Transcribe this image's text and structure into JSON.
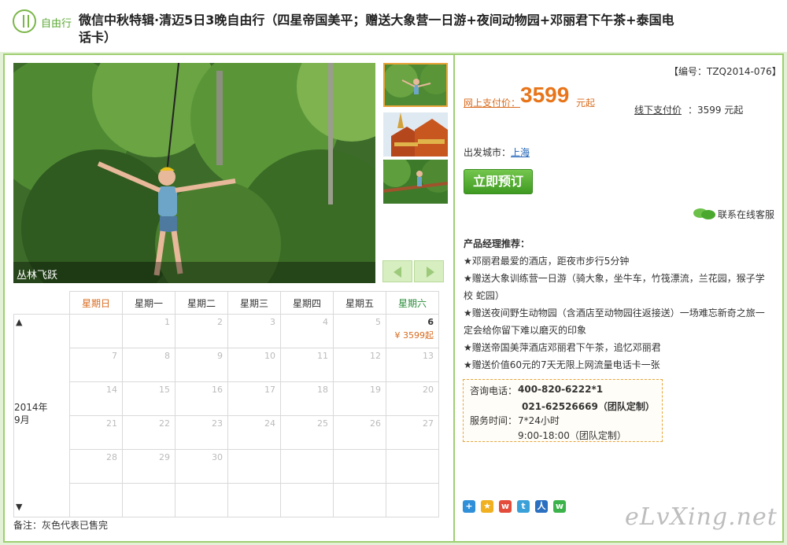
{
  "header": {
    "logo_label": "自由行",
    "title": "微信中秋特辑·清迈5日3晚自由行（四星帝国美平；赠送大象营一日游+夜间动物园+邓丽君下午茶+泰国电话卡）"
  },
  "gallery": {
    "caption": "丛林飞跃"
  },
  "calendar": {
    "weekdays": [
      "星期日",
      "星期一",
      "星期二",
      "星期三",
      "星期四",
      "星期五",
      "星期六"
    ],
    "year_label": "2014年",
    "month_label": "9月",
    "up": "▲",
    "down": "▼",
    "rows": [
      [
        "",
        "1",
        "2",
        "3",
        "4",
        "5",
        "6"
      ],
      [
        "7",
        "8",
        "9",
        "10",
        "11",
        "12",
        "13"
      ],
      [
        "14",
        "15",
        "16",
        "17",
        "18",
        "19",
        "20"
      ],
      [
        "21",
        "22",
        "23",
        "24",
        "25",
        "26",
        "27"
      ],
      [
        "28",
        "29",
        "30",
        "",
        "",
        "",
        ""
      ],
      [
        "",
        "",
        "",
        "",
        "",
        "",
        ""
      ]
    ],
    "price_on_6": "¥ 3599起",
    "note": "备注：灰色代表已售完"
  },
  "product": {
    "code": "【编号：TZQ2014-076】",
    "online_label": "网上支付价：",
    "online_price": "3599",
    "online_suffix": "元起",
    "offline_label": "线下支付价",
    "offline_value": "：3599 元起",
    "city_label": "出发城市：",
    "city": "上海",
    "book_button": "立即预订",
    "chat_link": "联系在线客服"
  },
  "recommend": {
    "title": "产品经理推荐：",
    "items": [
      "★邓丽君最爱的酒店，距夜市步行5分钟",
      "★赠送大象训练营一日游（骑大象，坐牛车，竹筏漂流，兰花园，猴子学校 蛇园）",
      "★赠送夜间野生动物园（含酒店至动物园往返接送）一场难忘新奇之旅一定会给你留下难以磨灭的印象",
      "★赠送帝国美萍酒店邓丽君下午茶，追忆邓丽君",
      "★赠送价值60元的7天无限上网流量电话卡一张"
    ]
  },
  "contact": {
    "phone_label": "咨询电话：",
    "phone1": "400-820-6222*1",
    "phone2": "021-62526669（团队定制）",
    "hours_label": "服务时间：",
    "hours1": "7*24小时",
    "hours2": "9:00-18:00（团队定制）"
  },
  "watermark": "eLvXing.net",
  "colors": {
    "accent_green": "#7ab648",
    "price_orange": "#e8751a",
    "frame_border": "#9fcf72"
  }
}
